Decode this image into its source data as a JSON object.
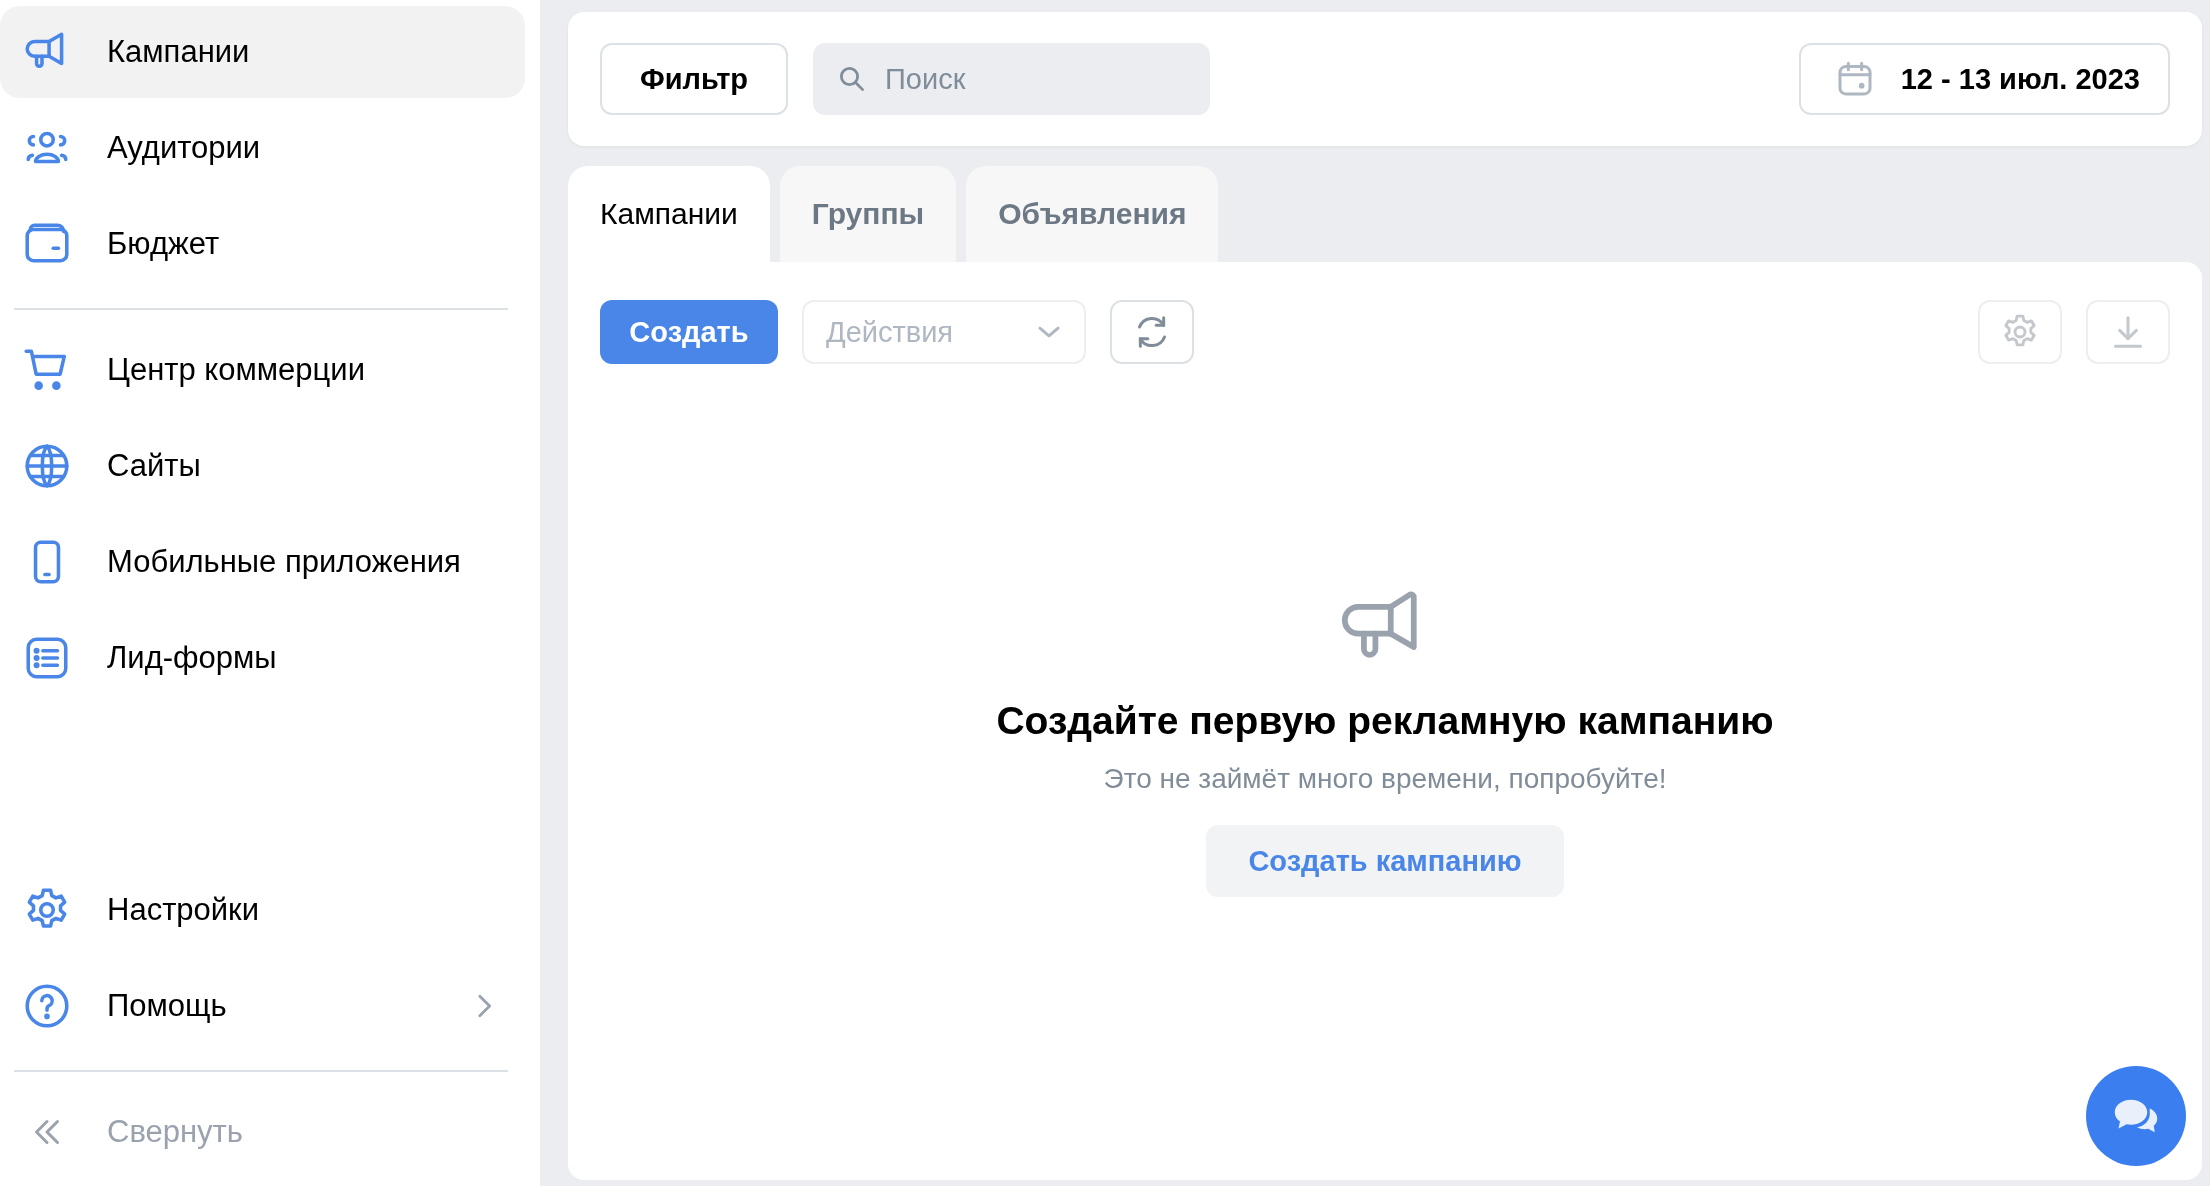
{
  "sidebar": {
    "sections": [
      {
        "items": [
          {
            "label": "Кампании",
            "selected": true
          },
          {
            "label": "Аудитории",
            "selected": false
          },
          {
            "label": "Бюджет",
            "selected": false
          }
        ]
      },
      {
        "items": [
          {
            "label": "Центр коммерции",
            "selected": false
          },
          {
            "label": "Сайты",
            "selected": false
          },
          {
            "label": "Мобильные приложения",
            "selected": false
          },
          {
            "label": "Лид-формы",
            "selected": false
          }
        ]
      }
    ],
    "bottom_items": [
      {
        "label": "Настройки",
        "selected": false,
        "has_submenu": false
      },
      {
        "label": "Помощь",
        "selected": false,
        "has_submenu": true
      }
    ],
    "collapse": {
      "label": "Свернуть"
    }
  },
  "top_bar": {
    "filter_button": "Фильтр",
    "search": {
      "placeholder": "Поиск"
    },
    "date_range": "12 - 13 июл. 2023"
  },
  "tabs": [
    {
      "label": "Кампании",
      "selected": true
    },
    {
      "label": "Группы",
      "selected": false
    },
    {
      "label": "Объявления",
      "selected": false
    }
  ],
  "toolbar": {
    "create_button": "Создать",
    "actions": {
      "label": "Действия",
      "disabled": true
    }
  },
  "empty_state": {
    "title": "Создайте первую рекламную кампанию",
    "subtitle": "Это не займёт много времени, попробуйте!",
    "button": "Создать кампанию"
  }
}
